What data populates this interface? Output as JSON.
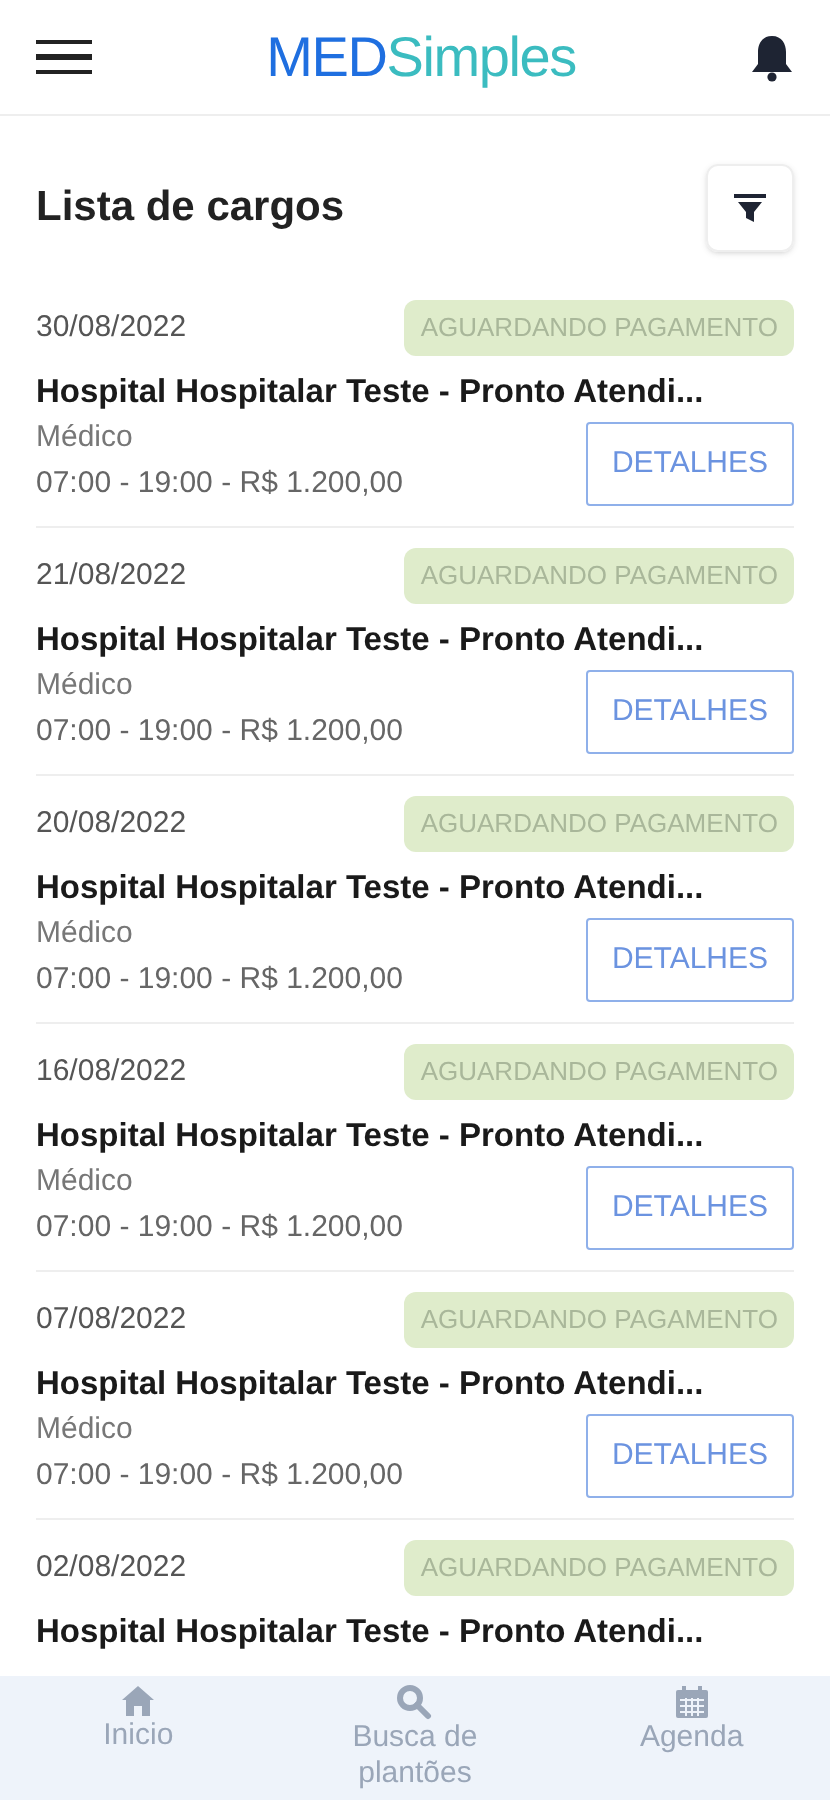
{
  "header": {
    "logo_left": "MED",
    "logo_right": "Simples"
  },
  "title": "Lista de cargos",
  "items": [
    {
      "date": "30/08/2022",
      "status": "AGUARDANDO PAGAMENTO",
      "name": "Hospital Hospitalar Teste - Pronto Atendi...",
      "role": "Médico",
      "details": "07:00 - 19:00 - R$ 1.200,00",
      "button": "DETALHES"
    },
    {
      "date": "21/08/2022",
      "status": "AGUARDANDO PAGAMENTO",
      "name": "Hospital Hospitalar Teste - Pronto Atendi...",
      "role": "Médico",
      "details": "07:00 - 19:00 - R$ 1.200,00",
      "button": "DETALHES"
    },
    {
      "date": "20/08/2022",
      "status": "AGUARDANDO PAGAMENTO",
      "name": "Hospital Hospitalar Teste - Pronto Atendi...",
      "role": "Médico",
      "details": "07:00 - 19:00 - R$ 1.200,00",
      "button": "DETALHES"
    },
    {
      "date": "16/08/2022",
      "status": "AGUARDANDO PAGAMENTO",
      "name": "Hospital Hospitalar Teste - Pronto Atendi...",
      "role": "Médico",
      "details": "07:00 - 19:00 - R$ 1.200,00",
      "button": "DETALHES"
    },
    {
      "date": "07/08/2022",
      "status": "AGUARDANDO PAGAMENTO",
      "name": "Hospital Hospitalar Teste - Pronto Atendi...",
      "role": "Médico",
      "details": "07:00 - 19:00 - R$ 1.200,00",
      "button": "DETALHES"
    },
    {
      "date": "02/08/2022",
      "status": "AGUARDANDO PAGAMENTO",
      "name": "Hospital Hospitalar Teste - Pronto Atendi..."
    }
  ],
  "nav": [
    {
      "kind": "home",
      "label": "Inicio"
    },
    {
      "kind": "search",
      "label": "Busca de plantões"
    },
    {
      "kind": "calendar",
      "label": "Agenda"
    }
  ]
}
